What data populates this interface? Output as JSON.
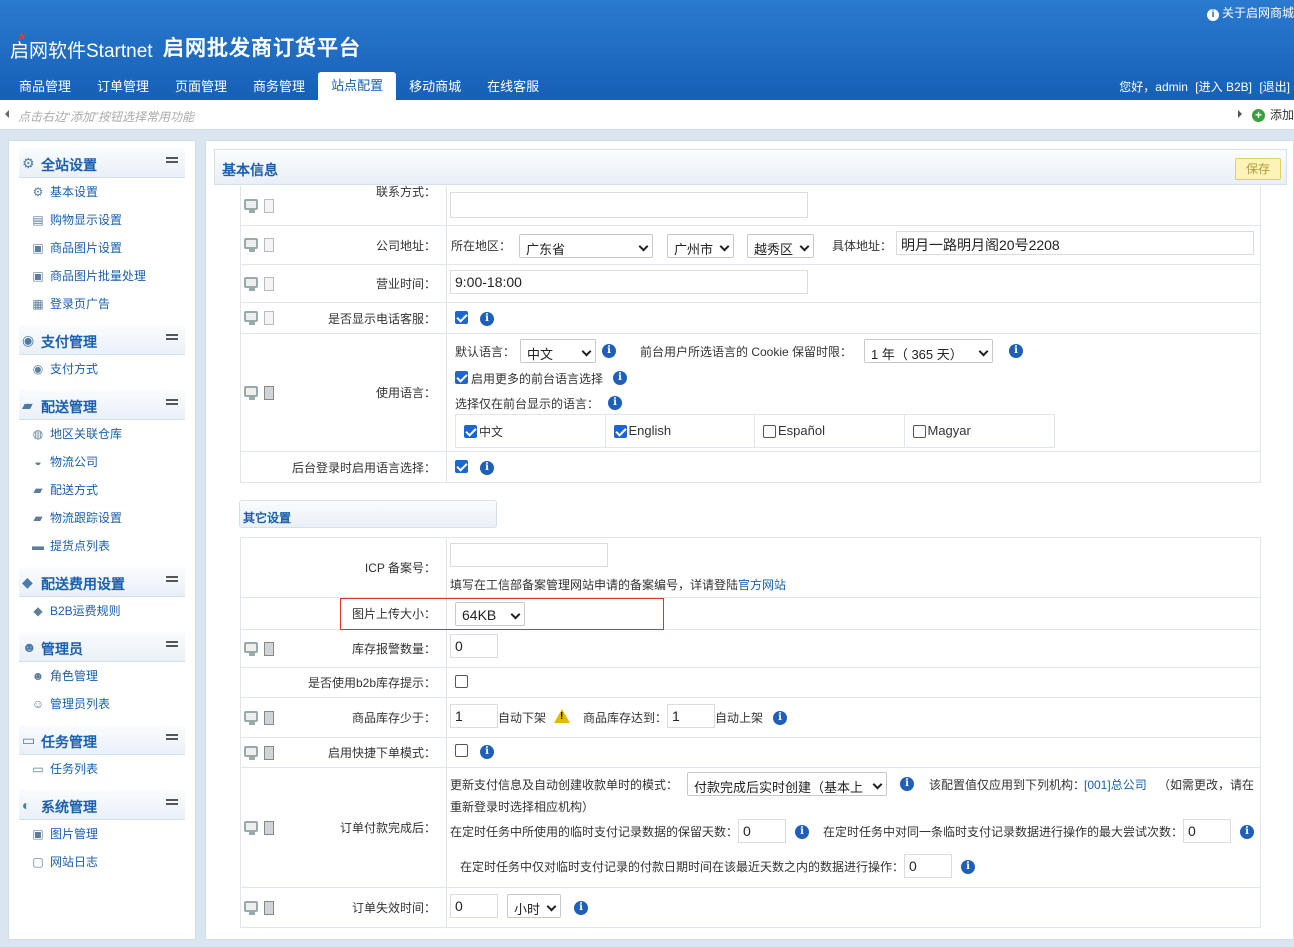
{
  "header": {
    "logo": "启网软件Startnet",
    "platform": "启网批发商订货平台",
    "about": "关于启网商城",
    "tabs": [
      "商品管理",
      "订单管理",
      "页面管理",
      "商务管理",
      "站点配置",
      "移动商城",
      "在线客服"
    ],
    "user": {
      "greeting": "您好，admin",
      "enter": "[进入 B2B]",
      "exit": "[退出]"
    }
  },
  "shortcut": {
    "hint": "点击右边“添加”按钮选择常用功能",
    "add": "添加"
  },
  "sidebar": [
    {
      "title": "全站设置",
      "icon": "gear-icon",
      "items": [
        {
          "label": "基本设置",
          "icon": "gear-icon"
        },
        {
          "label": "购物显示设置",
          "icon": "page-icon"
        },
        {
          "label": "商品图片设置",
          "icon": "image-icon"
        },
        {
          "label": "商品图片批量处理",
          "icon": "image-icon"
        },
        {
          "label": "登录页广告",
          "icon": "grid-icon"
        }
      ]
    },
    {
      "title": "支付管理",
      "icon": "coins-icon",
      "items": [
        {
          "label": "支付方式",
          "icon": "coins-icon"
        }
      ]
    },
    {
      "title": "配送管理",
      "icon": "truck-icon",
      "items": [
        {
          "label": "地区关联仓库",
          "icon": "globe-icon"
        },
        {
          "label": "物流公司",
          "icon": "car-icon"
        },
        {
          "label": "配送方式",
          "icon": "truck-icon"
        },
        {
          "label": "物流跟踪设置",
          "icon": "truck-icon"
        },
        {
          "label": "提货点列表",
          "icon": "box-icon"
        }
      ]
    },
    {
      "title": "配送费用设置",
      "icon": "fee-icon",
      "items": [
        {
          "label": "B2B运费规则",
          "icon": "fee-icon"
        }
      ]
    },
    {
      "title": "管理员",
      "icon": "user-icon",
      "items": [
        {
          "label": "角色管理",
          "icon": "user-icon"
        },
        {
          "label": "管理员列表",
          "icon": "users-icon"
        }
      ]
    },
    {
      "title": "任务管理",
      "icon": "window-icon",
      "items": [
        {
          "label": "任务列表",
          "icon": "window-icon"
        }
      ]
    },
    {
      "title": "系统管理",
      "icon": "system-icon",
      "items": [
        {
          "label": "图片管理",
          "icon": "image-icon"
        },
        {
          "label": "网站日志",
          "icon": "log-icon"
        }
      ]
    }
  ],
  "main": {
    "section_title": "基本信息",
    "save": "保存",
    "contact_label": "联系方式：",
    "address": {
      "label": "公司地址：",
      "region_label": "所在地区：",
      "province": "广东省",
      "city": "广州市",
      "district": "越秀区",
      "detail_label": "具体地址：",
      "detail": "明月一路明月阁20号2208"
    },
    "hours": {
      "label": "营业时间：",
      "value": "9:00-18:00"
    },
    "phone_service": {
      "label": "是否显示电话客服：",
      "checked": true
    },
    "language": {
      "label": "使用语言：",
      "default_label": "默认语言：",
      "default": "中文",
      "cookie_label": "前台用户所选语言的 Cookie 保留时限：",
      "cookie": "1 年（ 365 天）",
      "more_label": "启用更多的前台语言选择",
      "front_label": "选择仅在前台显示的语言：",
      "options": [
        {
          "name": "中文",
          "checked": true
        },
        {
          "name": "English",
          "checked": true
        },
        {
          "name": "Español",
          "checked": false
        },
        {
          "name": "Magyar",
          "checked": false
        }
      ]
    },
    "login_lang": {
      "label": "后台登录时启用语言选择：",
      "checked": true
    },
    "other_title": "其它设置",
    "icp": {
      "label": "ICP 备案号：",
      "hint": "填写在工信部备案管理网站申请的备案编号，详请登陆",
      "link": "官方网站"
    },
    "upload": {
      "label": "图片上传大小：",
      "value": "64KB"
    },
    "stock_warn": {
      "label": "库存报警数量：",
      "value": "0"
    },
    "b2b_stock": {
      "label": "是否使用b2b库存提示：",
      "checked": false
    },
    "stock_less": {
      "label": "商品库存少于：",
      "value": "1",
      "down": "自动下架",
      "reach_label": "商品库存达到：",
      "reach": "1",
      "up": "自动上架"
    },
    "quick_order": {
      "label": "启用快捷下单模式：",
      "checked": false
    },
    "payment": {
      "label": "订单付款完成后：",
      "mode_label": "更新支付信息及自动创建收款单时的模式：",
      "mode": "付款完成后实时创建（基本上",
      "note1": "该配置值仅应用到下列机构：",
      "org": "[001]总公司",
      "note2": "（如需更改，请在",
      "note3": "重新登录时选择相应机构）",
      "keep_label": "在定时任务中所使用的临时支付记录数据的保留天数：",
      "keep": "0",
      "retry_label": "在定时任务中对同一条临时支付记录数据进行操作的最大尝试次数：",
      "retry": "0",
      "recent_label": "在定时任务中仅对临时支付记录的付款日期时间在该最近天数之内的数据进行操作：",
      "recent": "0"
    },
    "expire": {
      "label": "订单失效时间：",
      "value": "0",
      "unit": "小时"
    }
  }
}
